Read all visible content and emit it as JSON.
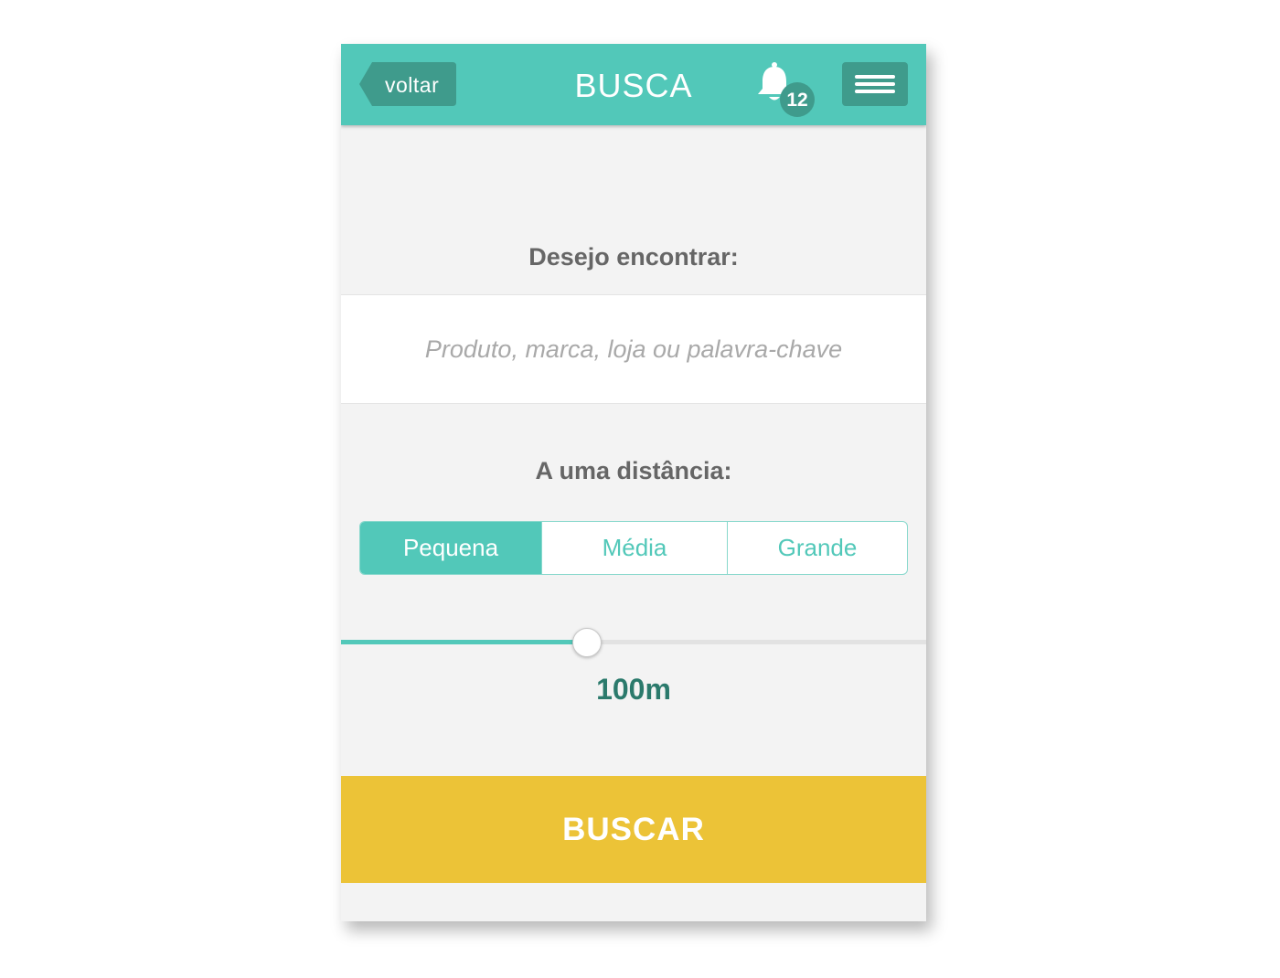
{
  "header": {
    "back_label": "voltar",
    "title": "BUSCA",
    "notifications_count": "12",
    "menu_icon": "hamburger-menu-icon",
    "bell_icon": "bell-icon"
  },
  "search": {
    "label": "Desejo encontrar:",
    "value": "",
    "placeholder": "Produto, marca, loja ou palavra-chave"
  },
  "distance": {
    "label": "A uma distância:",
    "options": [
      "Pequena",
      "Média",
      "Grande"
    ],
    "selected": "Pequena",
    "slider_fraction": 0.42,
    "value_text": "100m"
  },
  "submit_label": "BUSCAR",
  "colors": {
    "primary": "#52c8b9",
    "primary_dark": "#3f9b8c",
    "accent": "#ecc337",
    "value_text": "#2b7a6c"
  }
}
